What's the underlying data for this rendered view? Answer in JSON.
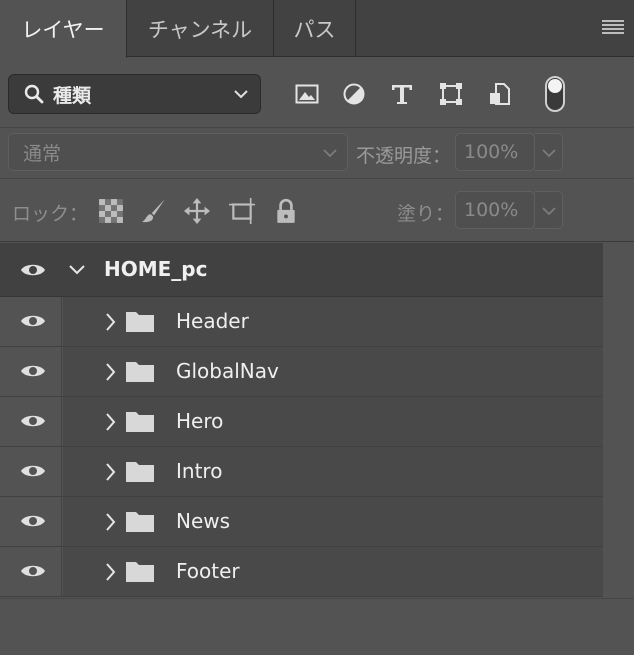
{
  "tabs": [
    {
      "label": "レイヤー",
      "active": true
    },
    {
      "label": "チャンネル",
      "active": false
    },
    {
      "label": "パス",
      "active": false
    }
  ],
  "filter": {
    "kind_label": "種類",
    "icons": [
      "image-filter-icon",
      "adjustment-filter-icon",
      "type-filter-icon",
      "shape-filter-icon",
      "smart-object-filter-icon"
    ]
  },
  "blend": {
    "mode": "通常",
    "opacity_label": "不透明度：",
    "opacity_value": "100%"
  },
  "lock": {
    "label": "ロック：",
    "fill_label": "塗り：",
    "fill_value": "100%",
    "icons": [
      "lock-transparent-icon",
      "lock-paint-icon",
      "lock-position-icon",
      "lock-artboard-icon",
      "lock-all-icon"
    ]
  },
  "layers": {
    "group_name": "HOME_pc",
    "children": [
      {
        "name": "Header"
      },
      {
        "name": "GlobalNav"
      },
      {
        "name": "Hero"
      },
      {
        "name": "Intro"
      },
      {
        "name": "News"
      },
      {
        "name": "Footer"
      }
    ]
  },
  "colors": {
    "panel_bg": "#535353",
    "tabbar_bg": "#424242",
    "group_row_bg": "#414141",
    "layer_row_bg": "#494949"
  }
}
